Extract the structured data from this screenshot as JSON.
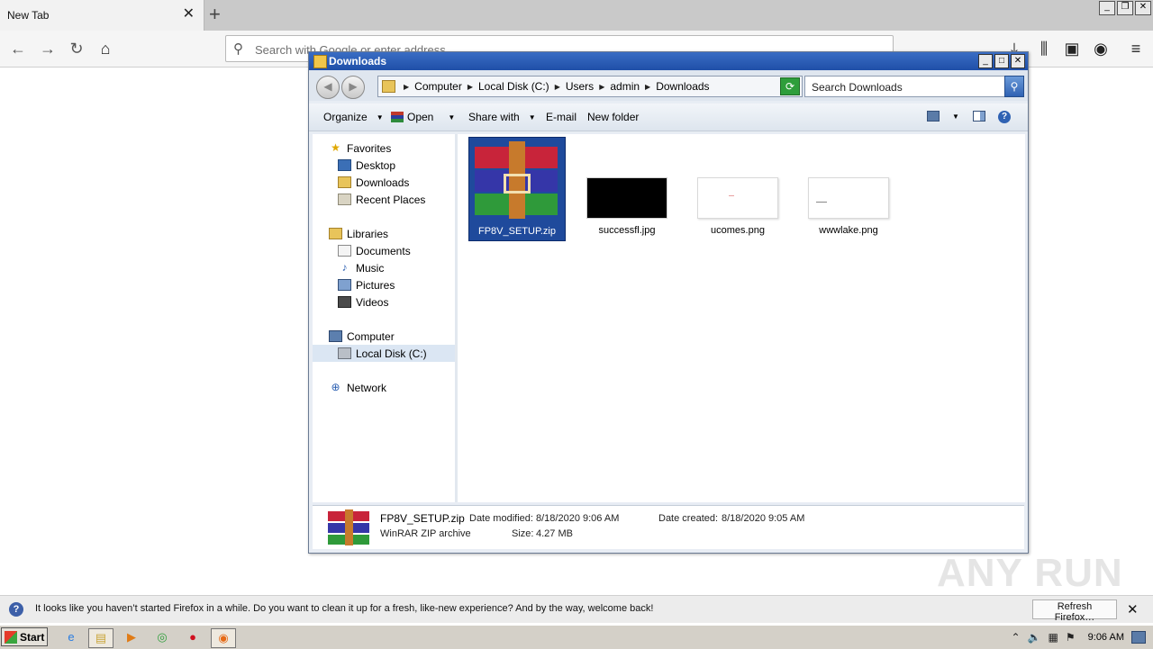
{
  "firefox": {
    "tab_title": "New Tab",
    "tab_close": "✕",
    "new_tab": "+",
    "url_placeholder": "Search with Google or enter address",
    "win_minimize": "_",
    "win_restore": "❐",
    "win_close": "✕"
  },
  "explorer": {
    "title": "Downloads",
    "breadcrumbs": [
      "Computer",
      "Local Disk (C:)",
      "Users",
      "admin",
      "Downloads"
    ],
    "search_placeholder": "Search Downloads",
    "toolbar": {
      "organize": "Organize",
      "open": "Open",
      "share_with": "Share with",
      "email": "E-mail",
      "new_folder": "New folder"
    },
    "nav": {
      "favorites": "Favorites",
      "desktop": "Desktop",
      "downloads": "Downloads",
      "recent_places": "Recent Places",
      "libraries": "Libraries",
      "documents": "Documents",
      "music": "Music",
      "pictures": "Pictures",
      "videos": "Videos",
      "computer": "Computer",
      "local_disk": "Local Disk (C:)",
      "network": "Network"
    },
    "files": [
      {
        "name": "FP8V_SETUP.zip"
      },
      {
        "name": "successfl.jpg"
      },
      {
        "name": "ucomes.png"
      },
      {
        "name": "wwwlake.png"
      }
    ],
    "details": {
      "name": "FP8V_SETUP.zip",
      "type": "WinRAR ZIP archive",
      "modified_label": "Date modified:",
      "modified_value": "8/18/2020 9:06 AM",
      "created_label": "Date created:",
      "created_value": "8/18/2020 9:05 AM",
      "size_label": "Size:",
      "size_value": "4.27 MB"
    }
  },
  "notification": {
    "message": "It looks like you haven’t started Firefox in a while. Do you want to clean it up for a fresh, like-new experience? And by the way, welcome back!",
    "button": "Refresh Firefox…",
    "close": "✕"
  },
  "watermark": "ANY RUN",
  "taskbar": {
    "start": "Start",
    "clock": "9:06 AM"
  }
}
